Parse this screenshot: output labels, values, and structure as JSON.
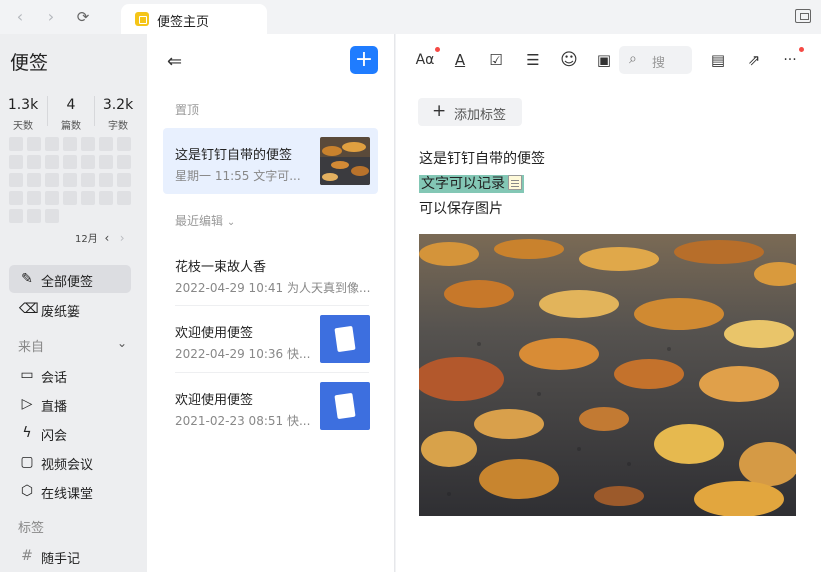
{
  "window": {
    "tab_title": "便签主页"
  },
  "sidebar": {
    "title": "便签",
    "stats": [
      {
        "value": "1.3k",
        "label": "天数"
      },
      {
        "value": "4",
        "label": "篇数"
      },
      {
        "value": "3.2k",
        "label": "字数"
      }
    ],
    "month": "12月",
    "nav_items": [
      {
        "label": "全部便签",
        "icon": "notes-icon",
        "active": true
      },
      {
        "label": "废纸篓",
        "icon": "trash-icon",
        "active": false
      }
    ],
    "source_section": "来自",
    "source_items": [
      {
        "label": "会话",
        "icon": "chat-icon"
      },
      {
        "label": "直播",
        "icon": "live-icon"
      },
      {
        "label": "闪会",
        "icon": "flash-meeting-icon"
      },
      {
        "label": "视频会议",
        "icon": "video-meeting-icon"
      },
      {
        "label": "在线课堂",
        "icon": "classroom-icon"
      }
    ],
    "tags_section": "标签",
    "tag_items": [
      {
        "label": "随手记",
        "icon": "hash-icon"
      }
    ]
  },
  "list": {
    "pinned_label": "置顶",
    "recent_label": "最近编辑",
    "pinned_notes": [
      {
        "title": "这是钉钉自带的便签",
        "meta": "星期一 11:55 文字可...",
        "thumb": "leaves-photo"
      }
    ],
    "recent_notes": [
      {
        "title": "花枝一束故人香",
        "meta": "2022-04-29 10:41 为人天真到像...",
        "thumb": ""
      },
      {
        "title": "欢迎使用便签",
        "meta": "2022-04-29 10:36 快...",
        "thumb": "note-graphic"
      },
      {
        "title": "欢迎使用便签",
        "meta": "2021-02-23 08:51 快...",
        "thumb": "note-graphic"
      }
    ]
  },
  "editor": {
    "toolbar": [
      {
        "name": "font-size-icon",
        "glyph": "Aα"
      },
      {
        "name": "text-color-icon",
        "glyph": "A"
      },
      {
        "name": "checkbox-icon",
        "glyph": "☑"
      },
      {
        "name": "divider-icon",
        "glyph": "☰"
      },
      {
        "name": "emoji-icon",
        "glyph": "☺"
      },
      {
        "name": "image-icon",
        "glyph": "▣"
      }
    ],
    "search_placeholder": "搜",
    "add_tag_label": "添加标签",
    "content": {
      "line1": "这是钉钉自带的便签",
      "line2": "文字可以记录",
      "line3": "可以保存图片"
    },
    "accent_color": "#1f7cff",
    "highlight_color": "#83c7b5"
  }
}
